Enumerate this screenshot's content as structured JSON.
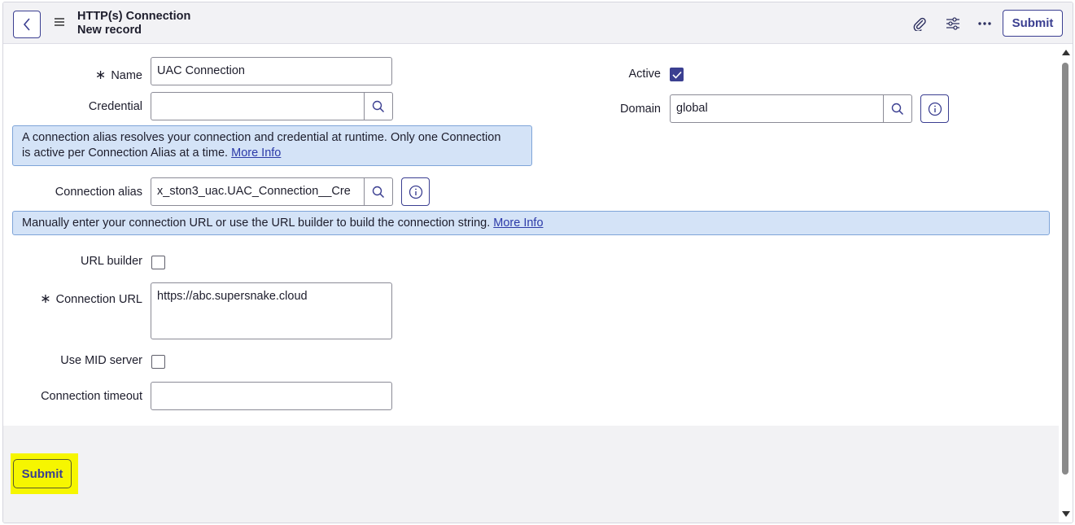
{
  "header": {
    "title": "HTTP(s) Connection",
    "subtitle": "New record",
    "submit_label": "Submit"
  },
  "form": {
    "required_marker": "∗",
    "name": {
      "label": "Name",
      "value": "UAC Connection"
    },
    "credential": {
      "label": "Credential",
      "value": ""
    },
    "active": {
      "label": "Active",
      "checked": true
    },
    "domain": {
      "label": "Domain",
      "value": "global"
    },
    "alias_info": {
      "line1": "A connection alias resolves your connection and credential at runtime. Only one Connection",
      "line2": "is active per Connection Alias at a time.",
      "link": "More Info"
    },
    "connection_alias": {
      "label": "Connection alias",
      "value": "x_ston3_uac.UAC_Connection__Cre"
    },
    "url_info": {
      "text": "Manually enter your connection URL or use the URL builder to build the connection string.",
      "link": "More Info"
    },
    "url_builder": {
      "label": "URL builder",
      "checked": false
    },
    "connection_url": {
      "label": "Connection URL",
      "value": "https://abc.supersnake.cloud"
    },
    "use_mid_server": {
      "label": "Use MID server",
      "checked": false
    },
    "connection_timeout": {
      "label": "Connection timeout",
      "value": ""
    }
  },
  "footer": {
    "submit_label": "Submit"
  },
  "colors": {
    "accent": "#3b3f91",
    "info_bg": "#d4e3f7",
    "highlight": "#f6f600"
  },
  "icons": [
    "chevron-left-icon",
    "hamburger-menu-icon",
    "paperclip-icon",
    "sliders-icon",
    "more-icon",
    "search-icon",
    "info-icon",
    "checkmark-icon"
  ]
}
